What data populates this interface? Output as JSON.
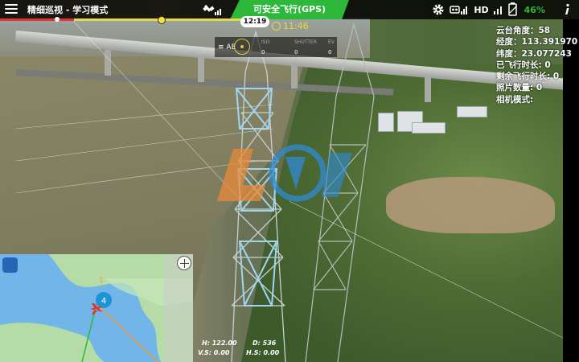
{
  "header": {
    "mode_title": "精细巡视 - 学习模式",
    "flight_status": "可安全飞行(GPS)",
    "time": "12:19",
    "timer_text": "11:46",
    "battery_percent": "46%",
    "hd_label": "HD",
    "gps_bars": "ill",
    "rc_bars": "ill"
  },
  "progress": {
    "fraction": 0.31,
    "red_fraction": 0.13
  },
  "exposure": {
    "mode": "AE",
    "iso_label": "ISO",
    "iso_value": "0",
    "shutter_label": "SHUTTER",
    "shutter_value": "0",
    "ev_label": "EV",
    "ev_value": "0"
  },
  "telemetry": {
    "gimbal_angle": "云台角度：58",
    "longitude": "经度：113.391970",
    "latitude": "纬度：23.077243",
    "flown_time": "已飞行时长: 0",
    "remaining_time": "剩余飞行时长: 0",
    "photo_count": "照片数量: 0",
    "camera_mode": "相机模式:"
  },
  "altitude": {
    "h": "H: 122.00",
    "d": "D: 536",
    "vs": "V.S: 0.00",
    "hs": "H.S: 0.00"
  },
  "map": {
    "waypoint_label": "4",
    "home_label": "1"
  },
  "colors": {
    "status_green": "#2db83b",
    "timer_yellow": "#f2d730",
    "progress_red": "#e63232",
    "progress_yellow": "#e8d84a",
    "map_water": "#72b5e8",
    "map_land": "#b5dba6"
  },
  "icons": [
    "menu-icon",
    "satellite-icon",
    "clock-icon",
    "settings-icon",
    "remote-controller-icon",
    "battery-icon",
    "info-icon",
    "map-layers-icon",
    "crosshair-icon",
    "aircraft-icon",
    "waypoint-icon"
  ]
}
